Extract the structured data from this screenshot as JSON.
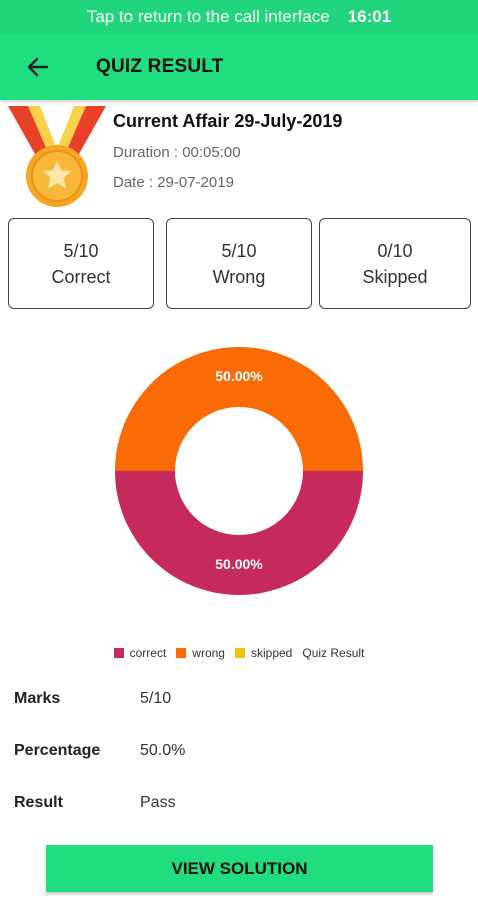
{
  "status_bar": {
    "call_text": "Tap to return to the call interface",
    "time": "16:01"
  },
  "app_bar": {
    "title": "QUIZ RESULT",
    "back_icon": "arrow-left-icon"
  },
  "quiz": {
    "title": "Current Affair 29-July-2019",
    "duration": "Duration : 00:05:00",
    "date": "Date : 29-07-2019",
    "icon": "medal-icon"
  },
  "stats": {
    "correct": {
      "value": "5/10",
      "label": "Correct"
    },
    "wrong": {
      "value": "5/10",
      "label": "Wrong"
    },
    "skipped": {
      "value": "0/10",
      "label": "Skipped"
    }
  },
  "chart_data": {
    "type": "pie",
    "style": "donut",
    "description": "Quiz Result",
    "legend_position": "bottom",
    "series": [
      {
        "name": "correct",
        "value": 50.0,
        "label": "50.00%",
        "color": "#c52a5a"
      },
      {
        "name": "wrong",
        "value": 50.0,
        "label": "50.00%",
        "color": "#fa6b06"
      },
      {
        "name": "skipped",
        "value": 0.0,
        "label": "",
        "color": "#f5c200"
      }
    ]
  },
  "summary": {
    "marks_label": "Marks",
    "marks_value": "5/10",
    "percentage_label": "Percentage",
    "percentage_value": "50.0%",
    "result_label": "Result",
    "result_value": "Pass"
  },
  "actions": {
    "view_solution": "VIEW SOLUTION"
  }
}
